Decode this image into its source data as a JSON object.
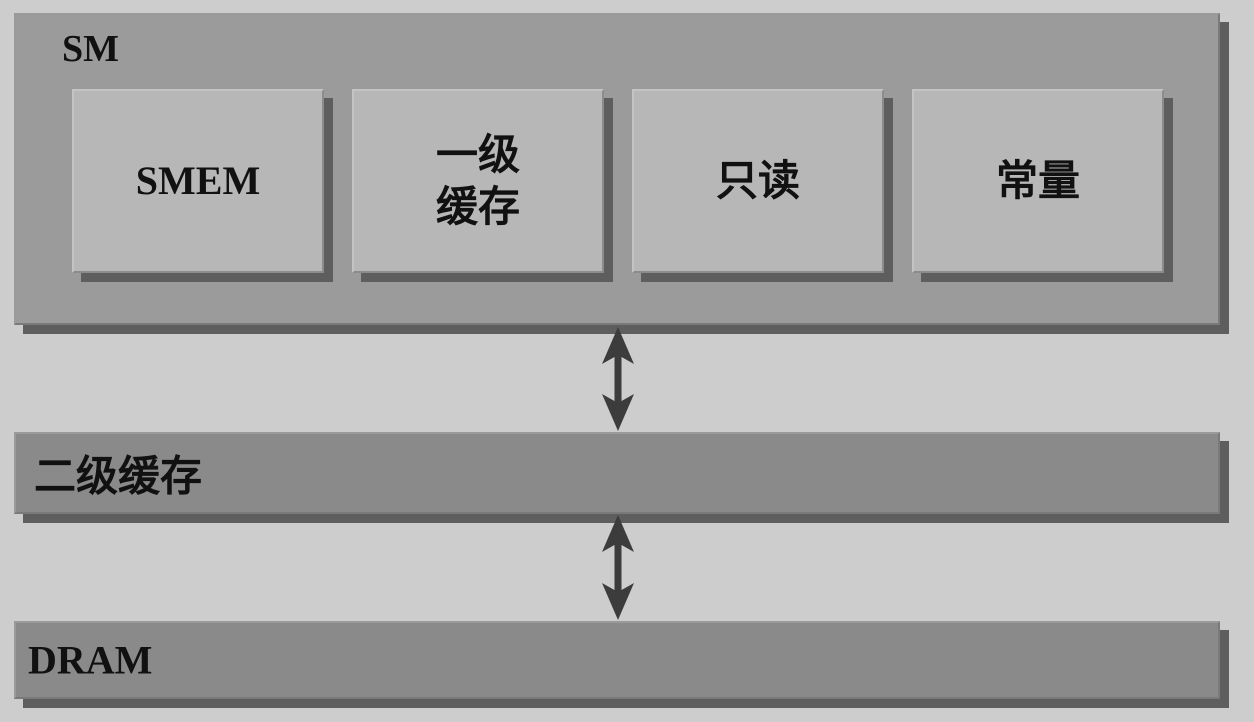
{
  "sm": {
    "title": "SM",
    "units": [
      {
        "id": "smem",
        "label": "SMEM"
      },
      {
        "id": "l1-cache",
        "line1": "一级",
        "line2": "缓存"
      },
      {
        "id": "readonly",
        "label": "只读"
      },
      {
        "id": "constant",
        "label": "常量"
      }
    ]
  },
  "l2": {
    "label": "二级缓存"
  },
  "dram": {
    "label": "DRAM"
  },
  "icons": [
    "double-arrow-icon",
    "double-arrow-icon"
  ],
  "colors": {
    "background": "#cdcdcd",
    "sm_block": "#9b9b9b",
    "unit_box": "#b7b7b7",
    "bar": "#8a8a8a",
    "shadow": "#5e5e5e",
    "arrow": "#3c3c3c"
  }
}
